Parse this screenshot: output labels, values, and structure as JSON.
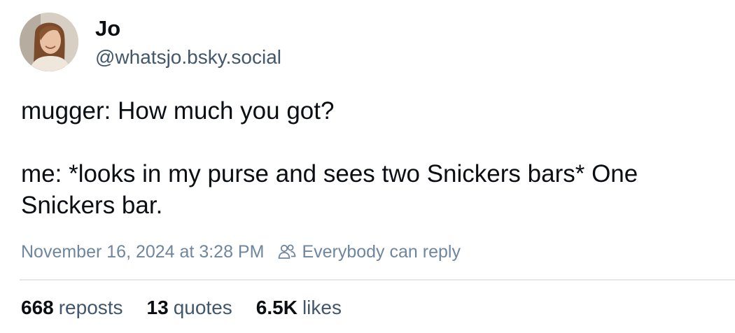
{
  "author": {
    "display_name": "Jo",
    "handle": "@whatsjo.bsky.social"
  },
  "post": {
    "lines": [
      "mugger: How much you got?",
      "me: *looks in my purse and sees two Snickers bars* One Snickers bar."
    ],
    "timestamp": "November 16, 2024 at 3:28 PM",
    "reply_setting": "Everybody can reply"
  },
  "stats": {
    "reposts": {
      "count": "668",
      "label": "reposts"
    },
    "quotes": {
      "count": "13",
      "label": "quotes"
    },
    "likes": {
      "count": "6.5K",
      "label": "likes"
    }
  },
  "icons": {
    "reply_setting_icon": "people-icon"
  },
  "colors": {
    "text_primary": "#0b0f14",
    "text_secondary": "#42576c",
    "text_meta": "#6f869f",
    "divider": "#e4e8ec"
  }
}
